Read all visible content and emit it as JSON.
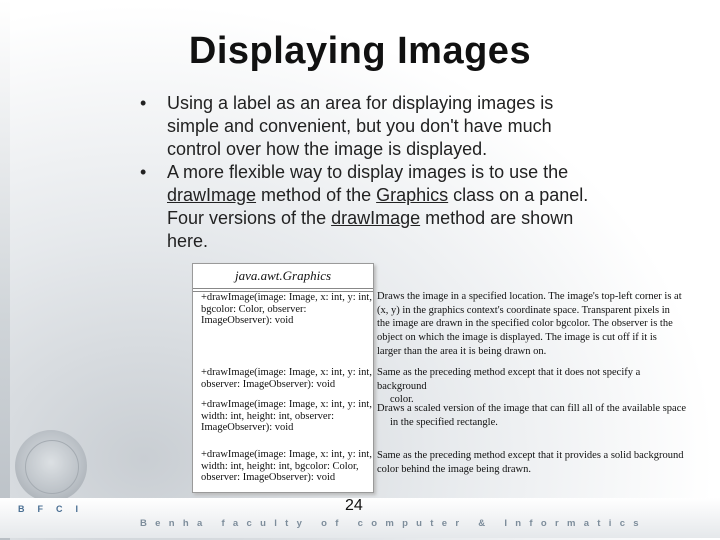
{
  "slide": {
    "title": "Displaying Images",
    "bullets": [
      {
        "marker": "•",
        "lines": [
          [
            {
              "t": "Using a label as an area for displaying images is"
            }
          ],
          [
            {
              "t": "simple and convenient, but you don't have much"
            }
          ],
          [
            {
              "t": "control over how the image is displayed."
            }
          ]
        ]
      },
      {
        "marker": "•",
        "lines": [
          [
            {
              "t": "A more flexible way to display images is to use the"
            }
          ],
          [
            {
              "t": "drawImage",
              "u": true
            },
            {
              "t": " method of the "
            },
            {
              "t": "Graphics",
              "u": true
            },
            {
              "t": " class on a panel."
            }
          ],
          [
            {
              "t": "Four versions of the "
            },
            {
              "t": "drawImage",
              "u": true
            },
            {
              "t": " method are shown"
            }
          ],
          [
            {
              "t": "here."
            }
          ]
        ]
      }
    ],
    "uml": {
      "class_name": "java.awt.Graphics",
      "methods": [
        [
          "+drawImage(image: Image, x: int, y: int,",
          "   bgcolor: Color, observer:",
          "   ImageObserver): void"
        ],
        [
          "+drawImage(image: Image, x: int, y: int,",
          "   observer: ImageObserver): void"
        ],
        [
          "+drawImage(image: Image, x: int, y: int,",
          "   width: int, height: int, observer:",
          "   ImageObserver): void"
        ],
        [
          "+drawImage(image: Image, x: int, y: int,",
          "   width: int, height: int, bgcolor: Color,",
          "   observer: ImageObserver): void"
        ]
      ],
      "descriptions": [
        [
          "Draws the image in a specified location. The image's top-left corner is at",
          "(x, y) in the graphics context's coordinate space. Transparent pixels in",
          "the image are drawn in the specified color bgcolor. The observer is the",
          "object on which the image is displayed. The image is cut off if it is",
          "larger than the area it is being drawn on."
        ],
        [
          "Same as the preceding method except that it does not specify a background",
          "color."
        ],
        [
          "Draws a scaled version of the image that can fill all of the available space",
          "in the specified rectangle."
        ],
        [
          "Same as the preceding method except that it provides a solid background",
          "color behind the image being drawn."
        ]
      ]
    },
    "footer": {
      "org_short": "BFCI",
      "org_full": "Benha faculty of computer & Informatics",
      "page_number": "24"
    }
  }
}
